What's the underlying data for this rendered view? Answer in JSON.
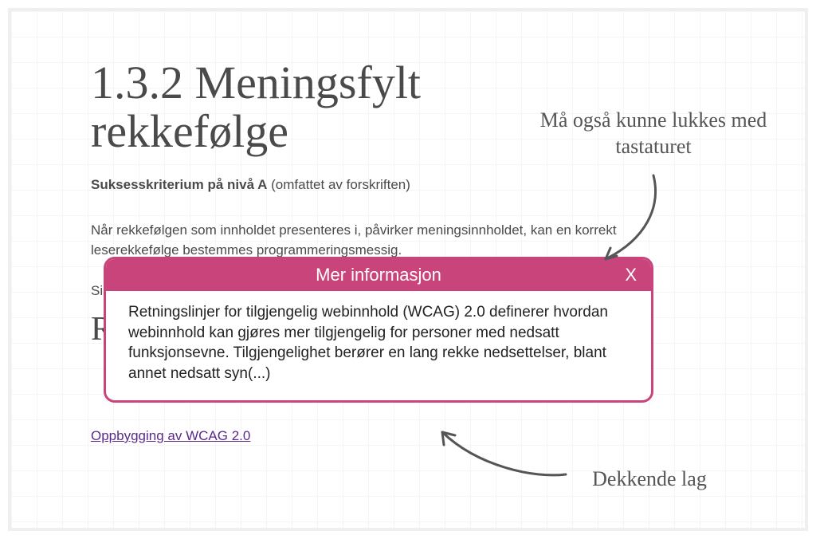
{
  "page": {
    "title": "1.3.2 Meningsfylt rekkefølge",
    "criterion_bold": "Suksesskriterium på nivå A",
    "criterion_rest": " (omfattet av forskriften)",
    "paragraph": "Når rekkefølgen som innholdet presenteres i, påvirker meningsinnholdet, kan en korrekt leserekkefølge bestemmes programmeringsmessig.",
    "truncated": "Sis",
    "obscured_heading": "R",
    "link_text": "Oppbygging av WCAG 2.0"
  },
  "popup": {
    "title": "Mer informasjon",
    "close_label": "X",
    "body": "Retningslinjer for tilgjengelig webinnhold (WCAG) 2.0 definerer hvordan webinnhold kan gjøres mer tilgjengelig for personer med nedsatt funksjonsevne. Tilgjengelighet berører en lang rekke nedsettelser, blant annet nedsatt syn(...)"
  },
  "annotations": {
    "top": "Må også kunne lukkes med tastaturet",
    "bottom": "Dekkende lag"
  },
  "colors": {
    "accent": "#c9447b",
    "link": "#5a2a8a",
    "text": "#4a4a4a"
  }
}
